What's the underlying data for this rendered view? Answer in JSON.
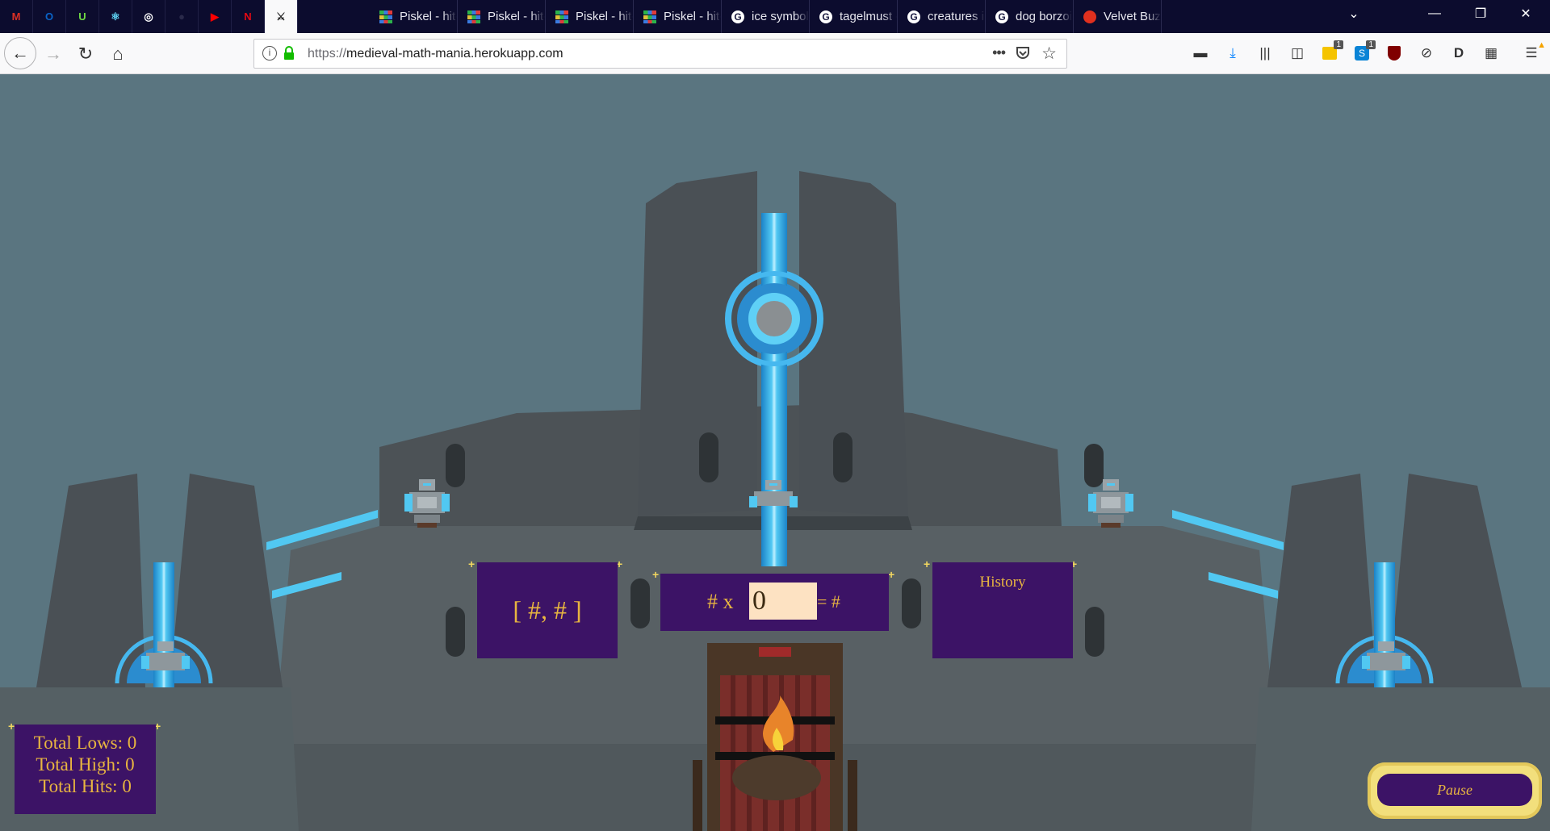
{
  "browser": {
    "pinned_tabs": [
      {
        "name": "gmail-icon",
        "glyph": "M",
        "color": "#d93025"
      },
      {
        "name": "outlook-icon",
        "glyph": "O",
        "color": "#0a64c8"
      },
      {
        "name": "upwork-icon",
        "glyph": "U",
        "color": "#6fda44"
      },
      {
        "name": "react-icon",
        "glyph": "⚛",
        "color": "#61dafb"
      },
      {
        "name": "globe-icon",
        "glyph": "◎",
        "color": "#ffffff"
      },
      {
        "name": "github-icon",
        "glyph": "●",
        "color": "#2a2a4a"
      },
      {
        "name": "youtube-icon",
        "glyph": "▶",
        "color": "#ff0000"
      },
      {
        "name": "netflix-icon",
        "glyph": "N",
        "color": "#e50914"
      },
      {
        "name": "swords-icon",
        "glyph": "⚔",
        "color": "#222222"
      }
    ],
    "tabs": [
      {
        "title": "Piskel - hit-t",
        "icon": "piskel-icon"
      },
      {
        "title": "Piskel - hit-t",
        "icon": "piskel-icon"
      },
      {
        "title": "Piskel - hit-t",
        "icon": "piskel-icon"
      },
      {
        "title": "Piskel - hit-t",
        "icon": "piskel-icon"
      },
      {
        "title": "ice symbol -",
        "icon": "google-icon"
      },
      {
        "title": "tagelmust -",
        "icon": "google-icon"
      },
      {
        "title": "creatures in",
        "icon": "google-icon"
      },
      {
        "title": "dog borzoi",
        "icon": "google-icon"
      },
      {
        "title": "Velvet Buzz",
        "icon": "tomato-icon"
      }
    ],
    "url_protocol": "https://",
    "url_host": "medieval-math-mania.herokuapp.com",
    "toolbar_badges": {
      "extension_a": "1",
      "extension_b": "1"
    }
  },
  "game": {
    "range_label": "[ #, # ]",
    "equation_prefix": "# x",
    "equation_suffix": "= #",
    "answer_value": "0",
    "history_label": "History",
    "stats": {
      "lows": "Total Lows: 0",
      "high": "Total High: 0",
      "hits": "Total Hits: 0"
    },
    "pause_label": "Pause"
  },
  "colors": {
    "panel_bg": "#3c1366",
    "panel_text": "#e8b540",
    "beam_blue": "#51c8f2",
    "sky": "#5a7580"
  }
}
